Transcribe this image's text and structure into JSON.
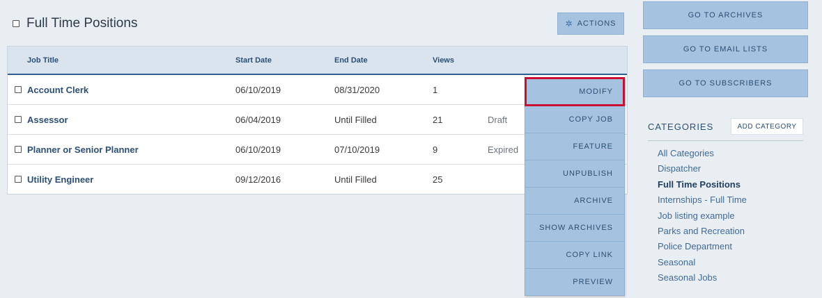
{
  "header": {
    "title": "Full Time Positions",
    "actions_label": "ACTIONS"
  },
  "table": {
    "columns": [
      "Job Title",
      "Start Date",
      "End Date",
      "Views"
    ],
    "rows": [
      {
        "title": "Account Clerk",
        "start": "06/10/2019",
        "end": "08/31/2020",
        "views": "1",
        "status": ""
      },
      {
        "title": "Assessor",
        "start": "06/04/2019",
        "end": "Until Filled",
        "views": "21",
        "status": "Draft"
      },
      {
        "title": "Planner or Senior Planner",
        "start": "06/10/2019",
        "end": "07/10/2019",
        "views": "9",
        "status": "Expired"
      },
      {
        "title": "Utility Engineer",
        "start": "09/12/2016",
        "end": "Until Filled",
        "views": "25",
        "status": ""
      }
    ]
  },
  "dropdown": {
    "items": [
      "MODIFY",
      "COPY JOB",
      "FEATURE",
      "UNPUBLISH",
      "ARCHIVE",
      "SHOW ARCHIVES",
      "COPY LINK",
      "PREVIEW"
    ],
    "highlight_color": "#c8102e"
  },
  "sidebar": {
    "buttons": [
      "GO TO ARCHIVES",
      "GO TO EMAIL LISTS",
      "GO TO SUBSCRIBERS"
    ],
    "categories_title": "CATEGORIES",
    "add_category_label": "ADD CATEGORY",
    "categories": [
      "All Categories",
      "Dispatcher",
      "Full Time Positions",
      "Internships - Full Time",
      "Job listing example",
      "Parks and Recreation",
      "Police Department",
      "Seasonal",
      "Seasonal Jobs"
    ],
    "active_category": "Full Time Positions"
  },
  "icons": {
    "actions": "gear-icon",
    "checkbox": "checkbox-icon"
  },
  "colors": {
    "button_bg": "#a5c2e0",
    "header_bg": "#d9e4ef",
    "accent": "#2f5f8f"
  }
}
